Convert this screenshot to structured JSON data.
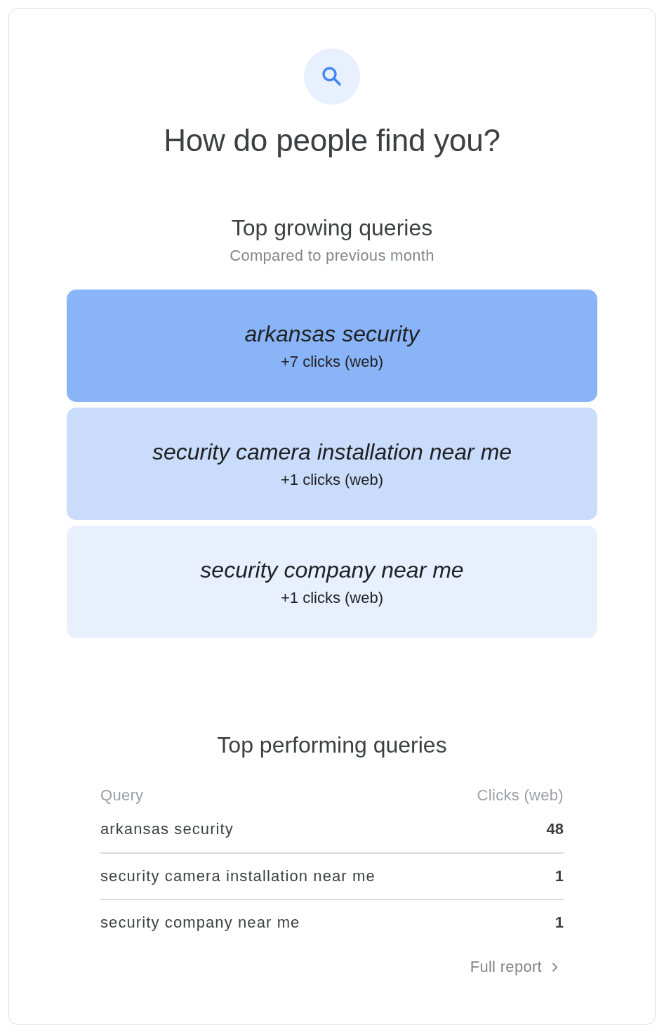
{
  "header": {
    "title": "How do people find you?"
  },
  "growing_queries": {
    "title": "Top growing queries",
    "subtitle": "Compared to previous month",
    "items": [
      {
        "query": "arkansas security",
        "change": "+7 clicks (web)",
        "color": "#8ab4f8"
      },
      {
        "query": "security camera installation near me",
        "change": "+1 clicks (web)",
        "color": "#c9dcfb"
      },
      {
        "query": "security company near me",
        "change": "+1 clicks (web)",
        "color": "#e8f0fe"
      }
    ]
  },
  "performing_queries": {
    "title": "Top performing queries",
    "columns": [
      "Query",
      "Clicks (web)"
    ],
    "rows": [
      {
        "query": "arkansas security",
        "clicks": "48"
      },
      {
        "query": "security camera installation near me",
        "clicks": "1"
      },
      {
        "query": "security company near me",
        "clicks": "1"
      }
    ],
    "link": "Full report"
  }
}
